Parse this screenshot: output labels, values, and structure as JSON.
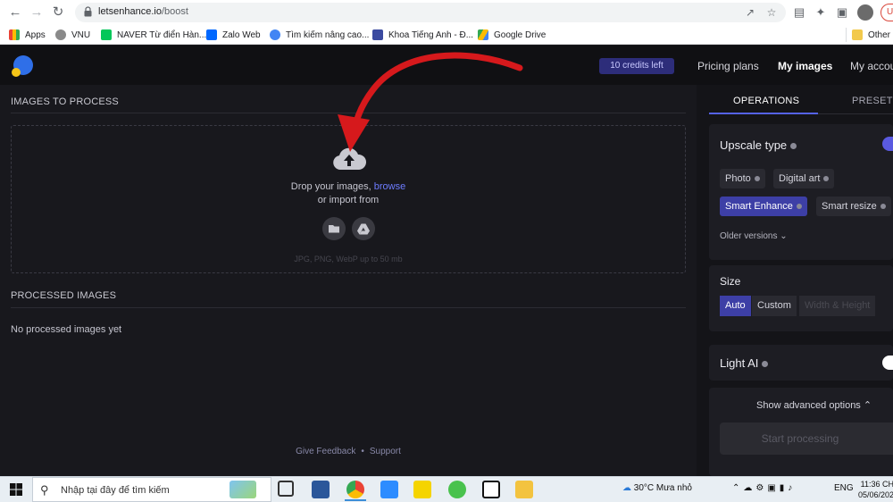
{
  "browser": {
    "url_host": "letsenhance.io",
    "url_path": "/boost",
    "bookmarks": [
      {
        "label": "Apps",
        "color": "#e94235"
      },
      {
        "label": "VNU",
        "color": "#8a8a8a"
      },
      {
        "label": "NAVER Từ điển Hàn...",
        "color": "#03c75a"
      },
      {
        "label": "Zalo Web",
        "color": "#0068ff"
      },
      {
        "label": "Tìm kiếm nâng cao...",
        "color": "#4285f4"
      },
      {
        "label": "Khoa Tiếng Anh - Đ...",
        "color": "#3b4aa0"
      },
      {
        "label": "Google Drive",
        "color": "#fbbc04"
      },
      {
        "label": "Other b",
        "color": "#f2c94c"
      }
    ],
    "profile_initial": "U"
  },
  "header": {
    "credits": "10 credits left",
    "nav": [
      "Pricing plans",
      "My images",
      "My accou"
    ]
  },
  "left": {
    "images_to_process": "IMAGES TO PROCESS",
    "drop_text_prefix": "Drop your images,",
    "browse": "browse",
    "import_from": "or import from",
    "formats": "JPG, PNG, WebP up to 50 mb",
    "processed_title": "PROCESSED IMAGES",
    "empty": "No processed images yet",
    "feedback": "Give Feedback",
    "bullet": "•",
    "support": "Support"
  },
  "right": {
    "tabs": [
      "OPERATIONS",
      "PRESETS"
    ],
    "upscale_title": "Upscale type",
    "upscale_options": [
      "Photo",
      "Digital art",
      "Smart Enhance",
      "Smart resize"
    ],
    "upscale_selected": "Smart Enhance",
    "older_versions": "Older versions",
    "size_title": "Size",
    "size_options": [
      "Auto",
      "Custom",
      "Width & Height"
    ],
    "size_selected": "Auto",
    "light_ai": "Light AI",
    "advanced": "Show advanced options",
    "start": "Start processing",
    "accent_color": "#3d3fa6"
  },
  "taskbar": {
    "search_placeholder": "Nhập tại đây để tìm kiếm",
    "weather": "30°C  Mưa nhỏ",
    "lang": "ENG",
    "time": "11:36 CH",
    "date": "05/06/202"
  }
}
